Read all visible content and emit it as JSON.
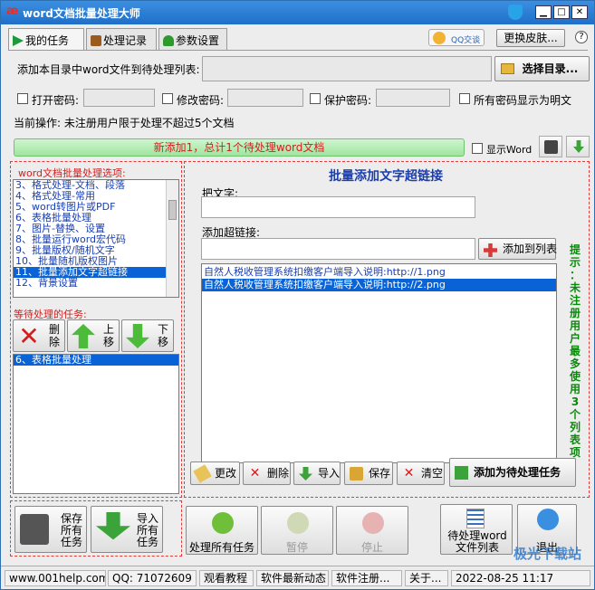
{
  "window": {
    "title": "word文档批量处理大师",
    "min": "▁",
    "max": "□",
    "close": "✕"
  },
  "tabs": [
    "我的任务",
    "处理记录",
    "参数设置"
  ],
  "qq_chat": "QQ交谈",
  "change_skin": "更换皮肤...",
  "add_dir_label": "添加本目录中word文件到待处理列表:",
  "select_dir": "选择目录...",
  "pw": {
    "open": "打开密码:",
    "modify": "修改密码:",
    "protect": "保护密码:",
    "show_plain": "所有密码显示为明文"
  },
  "current_op": "当前操作: 未注册用户限于处理不超过5个文档",
  "status_msg": "新添加1，总计1个待处理word文档",
  "show_word": "显示Word",
  "options_title": "word文档批量处理选项:",
  "options": [
    "3、格式处理-文档、段落",
    "4、格式处理-常用",
    "5、word转图片或PDF",
    "6、表格批量处理",
    "7、图片-替换、设置",
    "8、批量运行word宏代码",
    "9、批量版权/随机文字",
    "10、批量随机版权图片",
    "11、批量添加文字超链接",
    "12、背景设置"
  ],
  "options_selected": 8,
  "pending_title": "等待处理的任务:",
  "pending_btns": {
    "delete": "删除",
    "up": "上移",
    "down": "下移"
  },
  "pending_tasks": [
    "6、表格批量处理"
  ],
  "panel_title": "批量添加文字超链接",
  "text_label": "把文字:",
  "text_value": "",
  "link_label": "添加超链接:",
  "link_value": "",
  "add_to_list": "添加到列表",
  "links": [
    "自然人税收管理系统扣缴客户端导入说明:http://1.png",
    "自然人税收管理系统扣缴客户端导入说明:http://2.png"
  ],
  "links_selected": 1,
  "hint": "提示：未注册用户最多使用3个列表项",
  "actions": {
    "edit": "更改",
    "delete": "删除",
    "import": "导入",
    "save": "保存",
    "clear": "清空",
    "add_task": "添加为待处理任务"
  },
  "bottom": {
    "save_all": "保存所有任务",
    "import_all": "导入所有任务",
    "process_all": "处理所有任务",
    "pause": "暂停",
    "stop": "停止",
    "pending_list": "待处理word文件列表",
    "exit": "退出"
  },
  "statusbar": [
    "www.001help.com",
    "QQ: 71072609",
    "观看教程",
    "软件最新动态",
    "软件注册...",
    "关于...",
    "2022-08-25 11:17"
  ],
  "watermark": "极光下载站"
}
